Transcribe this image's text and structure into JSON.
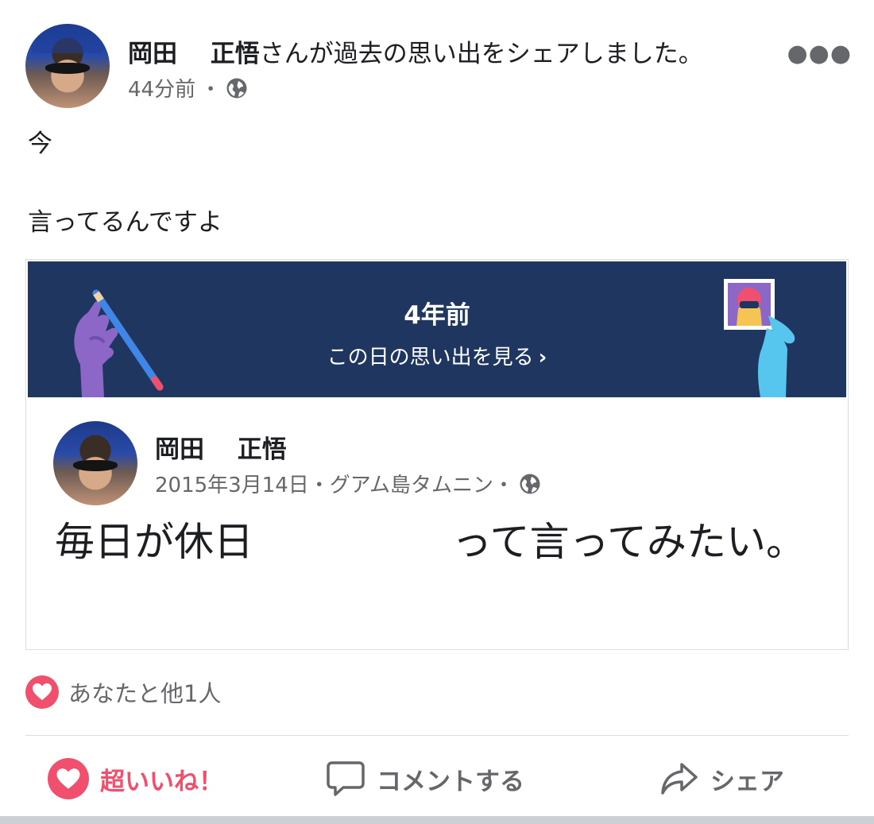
{
  "post": {
    "author": "岡田　 正悟",
    "action_text": "さんが過去の思い出をシェアしました。",
    "time": "44分前",
    "separator": "・",
    "text_lines": [
      "今",
      "言ってるんですよ"
    ]
  },
  "memory": {
    "years_ago": "4年前",
    "see_memories_label": "この日の思い出を見る",
    "chevron": "›"
  },
  "shared_post": {
    "author": "岡田　 正悟",
    "meta": "2015年3月14日・グアム島タムニン・",
    "body": "毎日が休日　　　　　って言ってみたい。"
  },
  "reactions": {
    "summary": "あなたと他1人"
  },
  "actions": {
    "love_label": "超いいね！",
    "comment_label": "コメントする",
    "share_label": "シェア"
  },
  "colors": {
    "love": "#f0506e",
    "banner": "#1f3660",
    "muted": "#65676b"
  },
  "icons": {
    "more": "more-dots-icon",
    "audience": "globe-icon",
    "love": "heart-icon",
    "comment": "comment-bubble-icon",
    "share": "share-arrow-icon"
  }
}
